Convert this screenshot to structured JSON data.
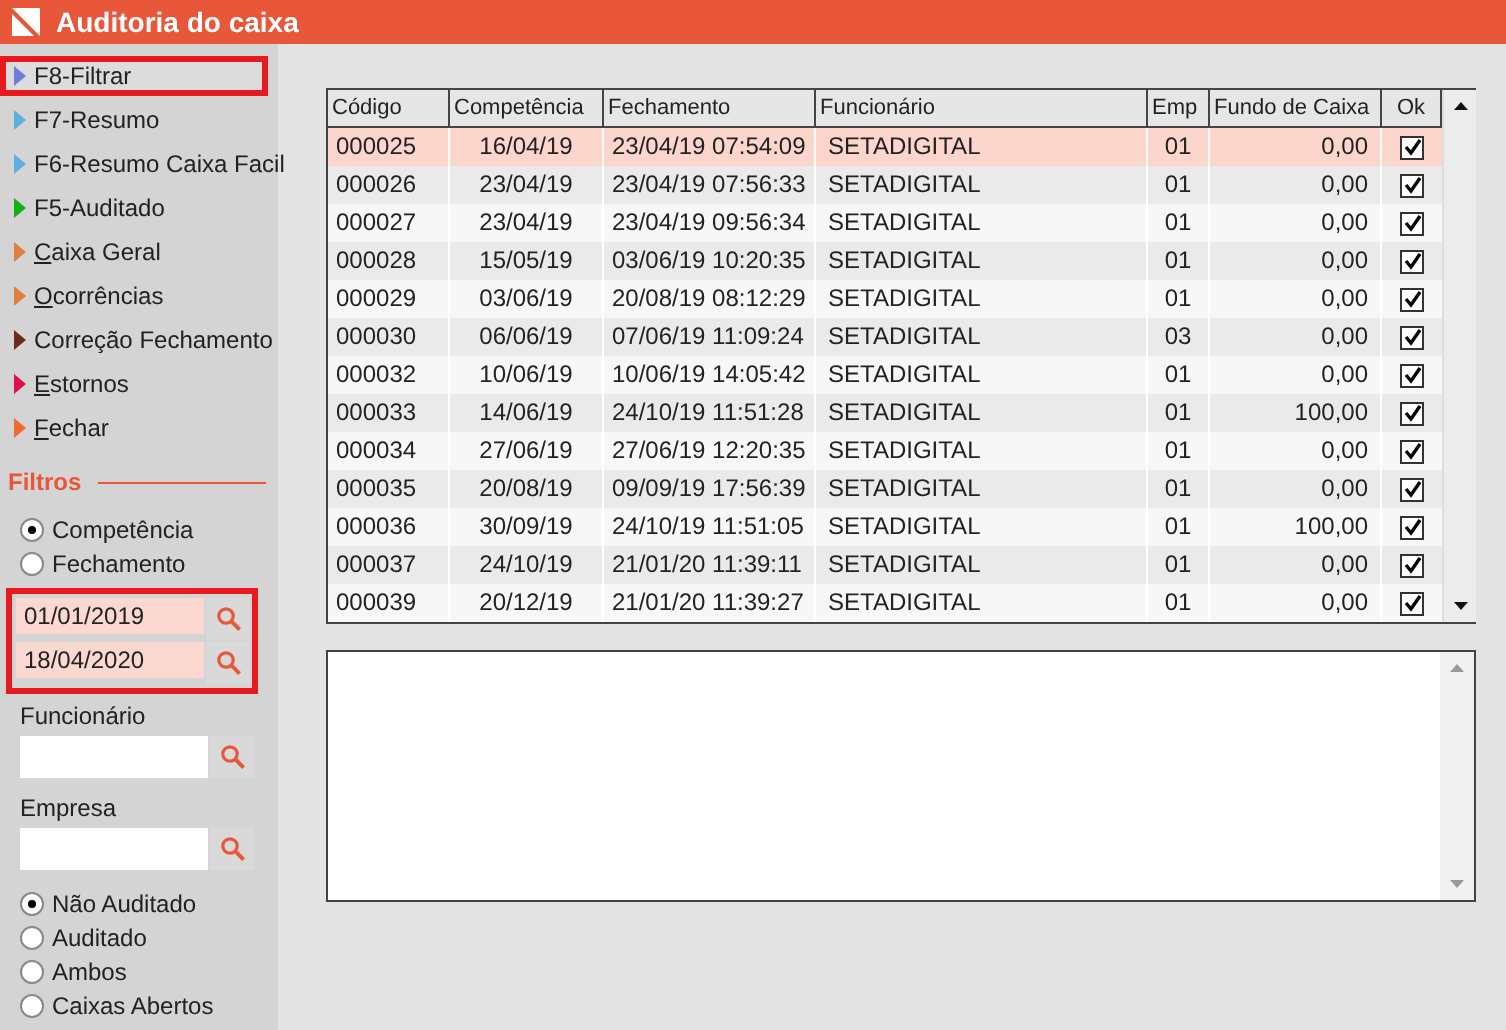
{
  "window": {
    "title": "Auditoria do caixa"
  },
  "menu": [
    {
      "label": "F8-Filtrar",
      "color": "#6b7fd8",
      "underline_first": false,
      "selected": true
    },
    {
      "label": "F7-Resumo",
      "color": "#5bb0e0",
      "underline_first": false,
      "selected": false
    },
    {
      "label": "F6-Resumo Caixa Facil",
      "color": "#5bb0e0",
      "underline_first": false,
      "selected": false
    },
    {
      "label": "F5-Auditado",
      "color": "#12b012",
      "underline_first": false,
      "selected": false
    },
    {
      "label": "Caixa Geral",
      "color": "#e08040",
      "underline_first": true,
      "selected": false
    },
    {
      "label": "Ocorrências",
      "color": "#e08040",
      "underline_first": true,
      "selected": false
    },
    {
      "label": "Correção Fechamento",
      "color": "#6b2c1a",
      "underline_first": false,
      "selected": false
    },
    {
      "label": "Estornos",
      "color": "#e0104a",
      "underline_first": true,
      "selected": false
    },
    {
      "label": "Fechar",
      "color": "#f06a30",
      "underline_first": true,
      "selected": false
    }
  ],
  "filters": {
    "title": "Filtros",
    "date_type": [
      {
        "label": "Competência",
        "selected": true
      },
      {
        "label": "Fechamento",
        "selected": false
      }
    ],
    "date_range": {
      "highlighted": true,
      "start": "01/01/2019",
      "end": "18/04/2020"
    },
    "employee": {
      "label": "Funcionário"
    },
    "company": {
      "label": "Empresa"
    },
    "status": [
      {
        "label": "Não Auditado",
        "selected": true
      },
      {
        "label": "Auditado",
        "selected": false
      },
      {
        "label": "Ambos",
        "selected": false
      },
      {
        "label": "Caixas Abertos",
        "selected": false
      }
    ]
  },
  "table": {
    "columns": [
      "Código",
      "Competência",
      "Fechamento",
      "Funcionário",
      "Emp",
      "Fundo de Caixa",
      "Ok"
    ],
    "rows": [
      {
        "cells": [
          "000025",
          "16/04/19",
          "23/04/19 07:54:09",
          "SETADIGITAL",
          "01",
          "0,00"
        ],
        "ok": true,
        "selected": true
      },
      {
        "cells": [
          "000026",
          "23/04/19",
          "23/04/19 07:56:33",
          "SETADIGITAL",
          "01",
          "0,00"
        ],
        "ok": true,
        "selected": false
      },
      {
        "cells": [
          "000027",
          "23/04/19",
          "23/04/19 09:56:34",
          "SETADIGITAL",
          "01",
          "0,00"
        ],
        "ok": true,
        "selected": false
      },
      {
        "cells": [
          "000028",
          "15/05/19",
          "03/06/19 10:20:35",
          "SETADIGITAL",
          "01",
          "0,00"
        ],
        "ok": true,
        "selected": false
      },
      {
        "cells": [
          "000029",
          "03/06/19",
          "20/08/19 08:12:29",
          "SETADIGITAL",
          "01",
          "0,00"
        ],
        "ok": true,
        "selected": false
      },
      {
        "cells": [
          "000030",
          "06/06/19",
          "07/06/19 11:09:24",
          "SETADIGITAL",
          "03",
          "0,00"
        ],
        "ok": true,
        "selected": false
      },
      {
        "cells": [
          "000032",
          "10/06/19",
          "10/06/19 14:05:42",
          "SETADIGITAL",
          "01",
          "0,00"
        ],
        "ok": true,
        "selected": false
      },
      {
        "cells": [
          "000033",
          "14/06/19",
          "24/10/19 11:51:28",
          "SETADIGITAL",
          "01",
          "100,00"
        ],
        "ok": true,
        "selected": false
      },
      {
        "cells": [
          "000034",
          "27/06/19",
          "27/06/19 12:20:35",
          "SETADIGITAL",
          "01",
          "0,00"
        ],
        "ok": true,
        "selected": false
      },
      {
        "cells": [
          "000035",
          "20/08/19",
          "09/09/19 17:56:39",
          "SETADIGITAL",
          "01",
          "0,00"
        ],
        "ok": true,
        "selected": false
      },
      {
        "cells": [
          "000036",
          "30/09/19",
          "24/10/19 11:51:05",
          "SETADIGITAL",
          "01",
          "100,00"
        ],
        "ok": true,
        "selected": false
      },
      {
        "cells": [
          "000037",
          "24/10/19",
          "21/01/20 11:39:11",
          "SETADIGITAL",
          "01",
          "0,00"
        ],
        "ok": true,
        "selected": false
      },
      {
        "cells": [
          "000039",
          "20/12/19",
          "21/01/20 11:39:27",
          "SETADIGITAL",
          "01",
          "0,00"
        ],
        "ok": true,
        "selected": false
      }
    ]
  }
}
